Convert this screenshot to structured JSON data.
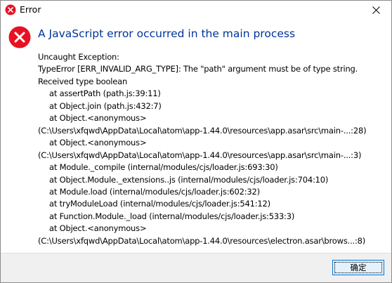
{
  "window": {
    "title": "Error",
    "close_icon": "close-icon",
    "title_icon": "error-icon"
  },
  "dialog": {
    "icon": "error-icon",
    "heading": "A JavaScript error occurred in the main process",
    "lines": [
      "Uncaught Exception:",
      "TypeError [ERR_INVALID_ARG_TYPE]: The \"path\" argument must be of type string.",
      "Received type boolean",
      "at assertPath (path.js:39:11)",
      "at Object.join (path.js:432:7)",
      "at Object.<anonymous>",
      "(C:\\Users\\xfqwd\\AppData\\Local\\atom\\app-1.44.0\\resources\\app.asar\\src\\main-...:28)",
      "at Object.<anonymous>",
      "(C:\\Users\\xfqwd\\AppData\\Local\\atom\\app-1.44.0\\resources\\app.asar\\src\\main-...:3)",
      "at Module._compile (internal/modules/cjs/loader.js:693:30)",
      "at Object.Module._extensions..js (internal/modules/cjs/loader.js:704:10)",
      "at Module.load (internal/modules/cjs/loader.js:602:32)",
      "at tryModuleLoad (internal/modules/cjs/loader.js:541:12)",
      "at Function.Module._load (internal/modules/cjs/loader.js:533:3)",
      "at Object.<anonymous>",
      "(C:\\Users\\xfqwd\\AppData\\Local\\atom\\app-1.44.0\\resources\\electron.asar\\brows...:8)"
    ]
  },
  "footer": {
    "ok_label": "确定"
  },
  "colors": {
    "heading": "#003399",
    "error_red": "#e81123",
    "button_border": "#0078d7",
    "footer_bg": "#f0f0f0"
  }
}
